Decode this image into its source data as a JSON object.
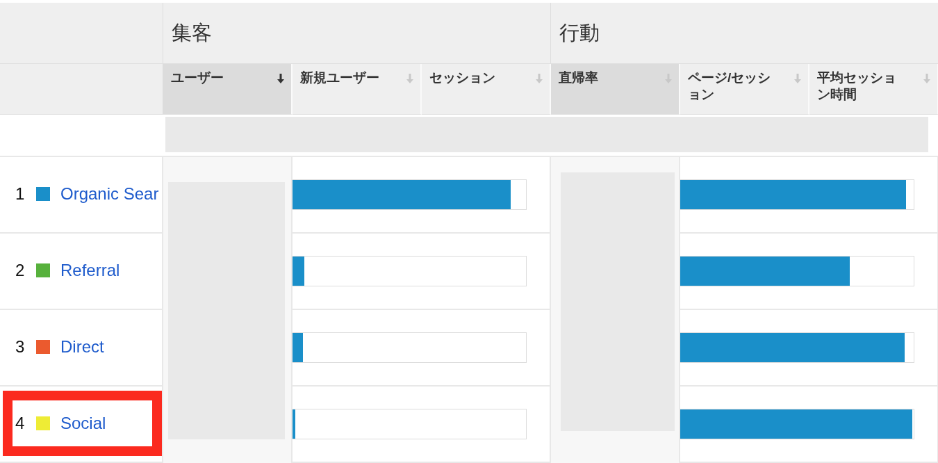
{
  "groups": [
    {
      "label": "集客"
    },
    {
      "label": "行動"
    }
  ],
  "columns": [
    {
      "label": "ユーザー",
      "sorted": true,
      "highlighted": true
    },
    {
      "label": "新規ユーザー",
      "sorted": false,
      "highlighted": false
    },
    {
      "label": "セッション",
      "sorted": false,
      "highlighted": false
    },
    {
      "label": "直帰率",
      "sorted": false,
      "highlighted": true
    },
    {
      "label": "ページ/セッション",
      "sorted": false,
      "highlighted": false
    },
    {
      "label": "平均セッション時間",
      "sorted": false,
      "highlighted": false
    }
  ],
  "rows": [
    {
      "rank": "1",
      "name": "Organic Sear",
      "color": "#1a8fc9",
      "highlighted": false,
      "acquisition_bar": {
        "level": 0.935
      },
      "behavior_bar": {
        "level": 0.967
      }
    },
    {
      "rank": "2",
      "name": "Referral",
      "color": "#57b13c",
      "highlighted": false,
      "acquisition_bar": {
        "level": 0.05
      },
      "behavior_bar": {
        "level": 0.727
      }
    },
    {
      "rank": "3",
      "name": "Direct",
      "color": "#eb5a2e",
      "highlighted": false,
      "acquisition_bar": {
        "level": 0.045
      },
      "behavior_bar": {
        "level": 0.96
      }
    },
    {
      "rank": "4",
      "name": "Social",
      "color": "#eeec35",
      "highlighted": true,
      "acquisition_bar": {
        "level": 0.012
      },
      "behavior_bar": {
        "level": 0.994
      }
    }
  ]
}
